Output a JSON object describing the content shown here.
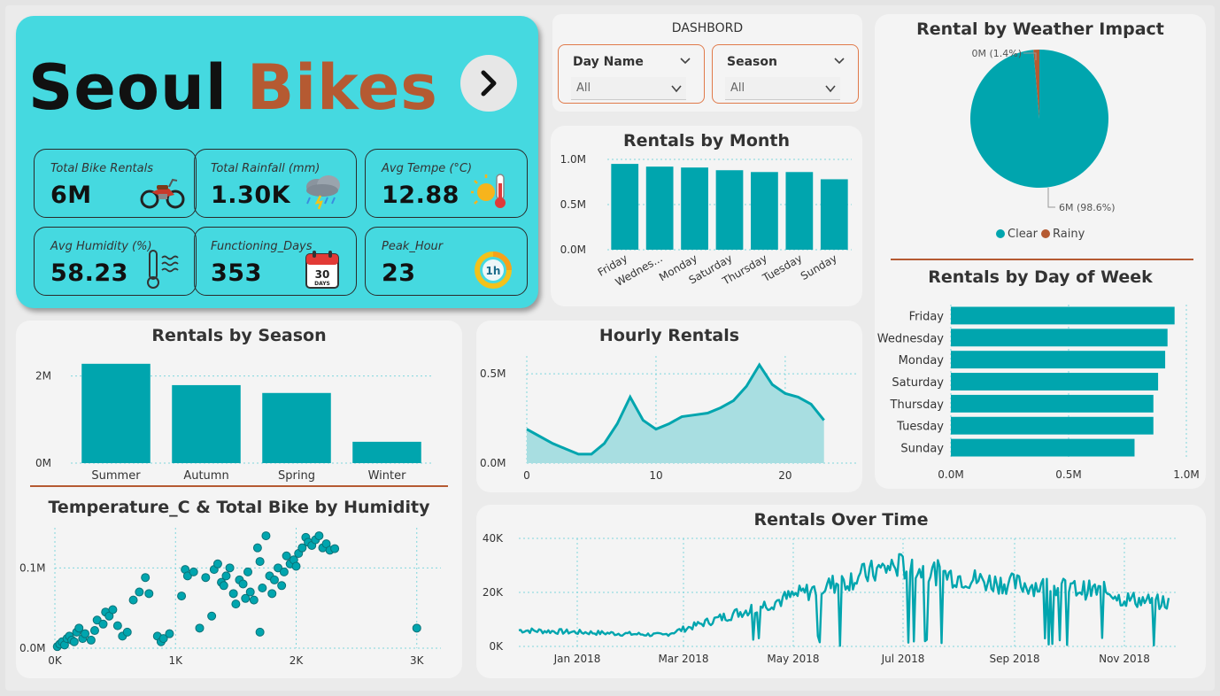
{
  "colors": {
    "teal": "#00a5ae",
    "rust": "#b55a32",
    "hero": "#45d9e0"
  },
  "hero": {
    "title_part1": "Seoul",
    "title_part2": "Bikes"
  },
  "kpis": [
    {
      "label": "Total Bike Rentals",
      "value": "6M",
      "icon": "motorcycle-icon"
    },
    {
      "label": "Total Rainfall (mm)",
      "value": "1.30K",
      "icon": "storm-cloud-icon"
    },
    {
      "label": "Avg Tempe (°C)",
      "value": "12.88",
      "icon": "thermometer-sun-icon"
    },
    {
      "label": "Avg Humidity (%)",
      "value": "58.23",
      "icon": "humidity-thermometer-icon"
    },
    {
      "label": "Functioning_Days",
      "value": "353",
      "icon": "calendar-icon"
    },
    {
      "label": "Peak_Hour",
      "value": "23",
      "icon": "hour-clock-icon"
    }
  ],
  "slicers": {
    "title": "DASHBORD",
    "day_name": {
      "label": "Day Name",
      "value": "All"
    },
    "season": {
      "label": "Season",
      "value": "All"
    }
  },
  "chart_data": [
    {
      "id": "month",
      "type": "bar",
      "title": "Rentals by Month",
      "categories": [
        "Friday",
        "Wednes...",
        "Monday",
        "Saturday",
        "Thursday",
        "Tuesday",
        "Sunday"
      ],
      "values": [
        0.95,
        0.92,
        0.91,
        0.88,
        0.86,
        0.86,
        0.78
      ],
      "ylim": [
        0,
        1.0
      ],
      "yticks": [
        "0.0M",
        "0.5M",
        "1.0M"
      ],
      "grid": true
    },
    {
      "id": "weather",
      "type": "pie",
      "title": "Rental by Weather Impact",
      "slices": [
        {
          "name": "Clear",
          "value": 98.6,
          "label": "6M (98.6%)",
          "color": "#00a5ae"
        },
        {
          "name": "Rainy",
          "value": 1.4,
          "label": "0M (1.4%)",
          "color": "#b55a32"
        }
      ],
      "legend": "bottom"
    },
    {
      "id": "dow",
      "type": "bar",
      "orientation": "horizontal",
      "title": "Rentals by Day of Week",
      "categories": [
        "Friday",
        "Wednesday",
        "Monday",
        "Saturday",
        "Thursday",
        "Tuesday",
        "Sunday"
      ],
      "values": [
        0.95,
        0.92,
        0.91,
        0.88,
        0.86,
        0.86,
        0.78
      ],
      "xlim": [
        0,
        1.0
      ],
      "xticks": [
        "0.0M",
        "0.5M",
        "1.0M"
      ],
      "grid": true
    },
    {
      "id": "season",
      "type": "bar",
      "title": "Rentals by Season",
      "categories": [
        "Summer",
        "Autumn",
        "Spring",
        "Winter"
      ],
      "values": [
        2.28,
        1.79,
        1.61,
        0.49
      ],
      "ylim": [
        0,
        2.5
      ],
      "yticks": [
        "0M",
        "2M"
      ],
      "grid": true
    },
    {
      "id": "hourly",
      "type": "area",
      "title": "Hourly Rentals",
      "x": [
        0,
        1,
        2,
        3,
        4,
        5,
        6,
        7,
        8,
        9,
        10,
        11,
        12,
        13,
        14,
        15,
        16,
        17,
        18,
        19,
        20,
        21,
        22,
        23
      ],
      "values": [
        0.19,
        0.15,
        0.11,
        0.08,
        0.05,
        0.05,
        0.11,
        0.22,
        0.37,
        0.24,
        0.19,
        0.22,
        0.26,
        0.27,
        0.28,
        0.31,
        0.35,
        0.43,
        0.55,
        0.44,
        0.39,
        0.37,
        0.33,
        0.24
      ],
      "ylim": [
        0,
        0.6
      ],
      "yticks": [
        "0.0M",
        "0.5M"
      ],
      "xticks": [
        "0",
        "10",
        "20"
      ],
      "grid": true
    },
    {
      "id": "humidity",
      "type": "scatter",
      "title": "Temperature_C & Total Bike by Humidity",
      "xlim": [
        0,
        3200
      ],
      "ylim": [
        0,
        0.15
      ],
      "xticks": [
        "0K",
        "1K",
        "2K",
        "3K"
      ],
      "yticks": [
        "0.0M",
        "0.1M"
      ],
      "points": [
        [
          20,
          0.002
        ],
        [
          40,
          0.005
        ],
        [
          60,
          0.008
        ],
        [
          80,
          0.004
        ],
        [
          100,
          0.012
        ],
        [
          120,
          0.015
        ],
        [
          140,
          0.01
        ],
        [
          160,
          0.008
        ],
        [
          180,
          0.02
        ],
        [
          200,
          0.025
        ],
        [
          230,
          0.012
        ],
        [
          250,
          0.018
        ],
        [
          300,
          0.01
        ],
        [
          330,
          0.022
        ],
        [
          350,
          0.035
        ],
        [
          400,
          0.03
        ],
        [
          420,
          0.045
        ],
        [
          450,
          0.04
        ],
        [
          480,
          0.048
        ],
        [
          520,
          0.028
        ],
        [
          560,
          0.015
        ],
        [
          600,
          0.02
        ],
        [
          650,
          0.06
        ],
        [
          700,
          0.07
        ],
        [
          750,
          0.088
        ],
        [
          780,
          0.068
        ],
        [
          850,
          0.015
        ],
        [
          880,
          0.008
        ],
        [
          900,
          0.012
        ],
        [
          950,
          0.018
        ],
        [
          1050,
          0.065
        ],
        [
          1080,
          0.098
        ],
        [
          1100,
          0.09
        ],
        [
          1150,
          0.095
        ],
        [
          1200,
          0.025
        ],
        [
          1250,
          0.088
        ],
        [
          1300,
          0.04
        ],
        [
          1320,
          0.098
        ],
        [
          1350,
          0.105
        ],
        [
          1380,
          0.082
        ],
        [
          1400,
          0.078
        ],
        [
          1420,
          0.09
        ],
        [
          1450,
          0.1
        ],
        [
          1480,
          0.068
        ],
        [
          1500,
          0.055
        ],
        [
          1530,
          0.085
        ],
        [
          1560,
          0.08
        ],
        [
          1580,
          0.062
        ],
        [
          1600,
          0.095
        ],
        [
          1620,
          0.07
        ],
        [
          1650,
          0.06
        ],
        [
          1680,
          0.125
        ],
        [
          1700,
          0.02
        ],
        [
          1700,
          0.108
        ],
        [
          1720,
          0.075
        ],
        [
          1750,
          0.14
        ],
        [
          1780,
          0.09
        ],
        [
          1800,
          0.068
        ],
        [
          1820,
          0.085
        ],
        [
          1850,
          0.1
        ],
        [
          1880,
          0.078
        ],
        [
          1900,
          0.095
        ],
        [
          1920,
          0.115
        ],
        [
          1950,
          0.105
        ],
        [
          1980,
          0.11
        ],
        [
          2000,
          0.102
        ],
        [
          2020,
          0.118
        ],
        [
          2050,
          0.125
        ],
        [
          2080,
          0.138
        ],
        [
          2100,
          0.132
        ],
        [
          2130,
          0.128
        ],
        [
          2160,
          0.135
        ],
        [
          2190,
          0.14
        ],
        [
          2220,
          0.125
        ],
        [
          2250,
          0.13
        ],
        [
          2280,
          0.122
        ],
        [
          2320,
          0.124
        ],
        [
          3000,
          0.025
        ]
      ]
    },
    {
      "id": "time",
      "type": "line",
      "title": "Rentals Over Time",
      "xticks": [
        "Jan 2018",
        "Mar 2018",
        "May 2018",
        "Jul 2018",
        "Sep 2018",
        "Nov 2018"
      ],
      "yticks": [
        "0K",
        "20K",
        "40K"
      ],
      "ylim": [
        0,
        40000
      ],
      "grid": true
    }
  ]
}
